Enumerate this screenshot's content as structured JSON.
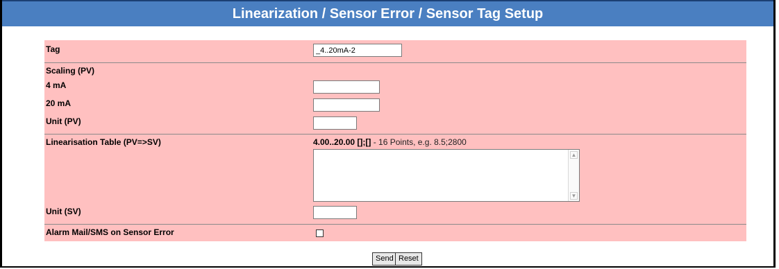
{
  "header": {
    "title": "Linearization / Sensor Error / Sensor Tag Setup"
  },
  "form": {
    "tag_label": "Tag",
    "tag_value": "_4..20mA-2",
    "scaling_label": "Scaling (PV)",
    "ma4_label": "4 mA",
    "ma4_value": "",
    "ma20_label": "20 mA",
    "ma20_value": "",
    "unit_pv_label": "Unit (PV)",
    "unit_pv_value": "",
    "lin_table_label": "Linearisation Table (PV=>SV)",
    "lin_table_range": "4.00..20.00",
    "lin_table_sep": "[];[]",
    "lin_table_hint": " - 16 Points, e.g. 8.5;2800",
    "lin_table_value": "",
    "unit_sv_label": "Unit (SV)",
    "unit_sv_value": "",
    "alarm_label": "Alarm Mail/SMS on Sensor Error",
    "alarm_checked": false
  },
  "buttons": {
    "send": "Send",
    "reset": "Reset"
  }
}
